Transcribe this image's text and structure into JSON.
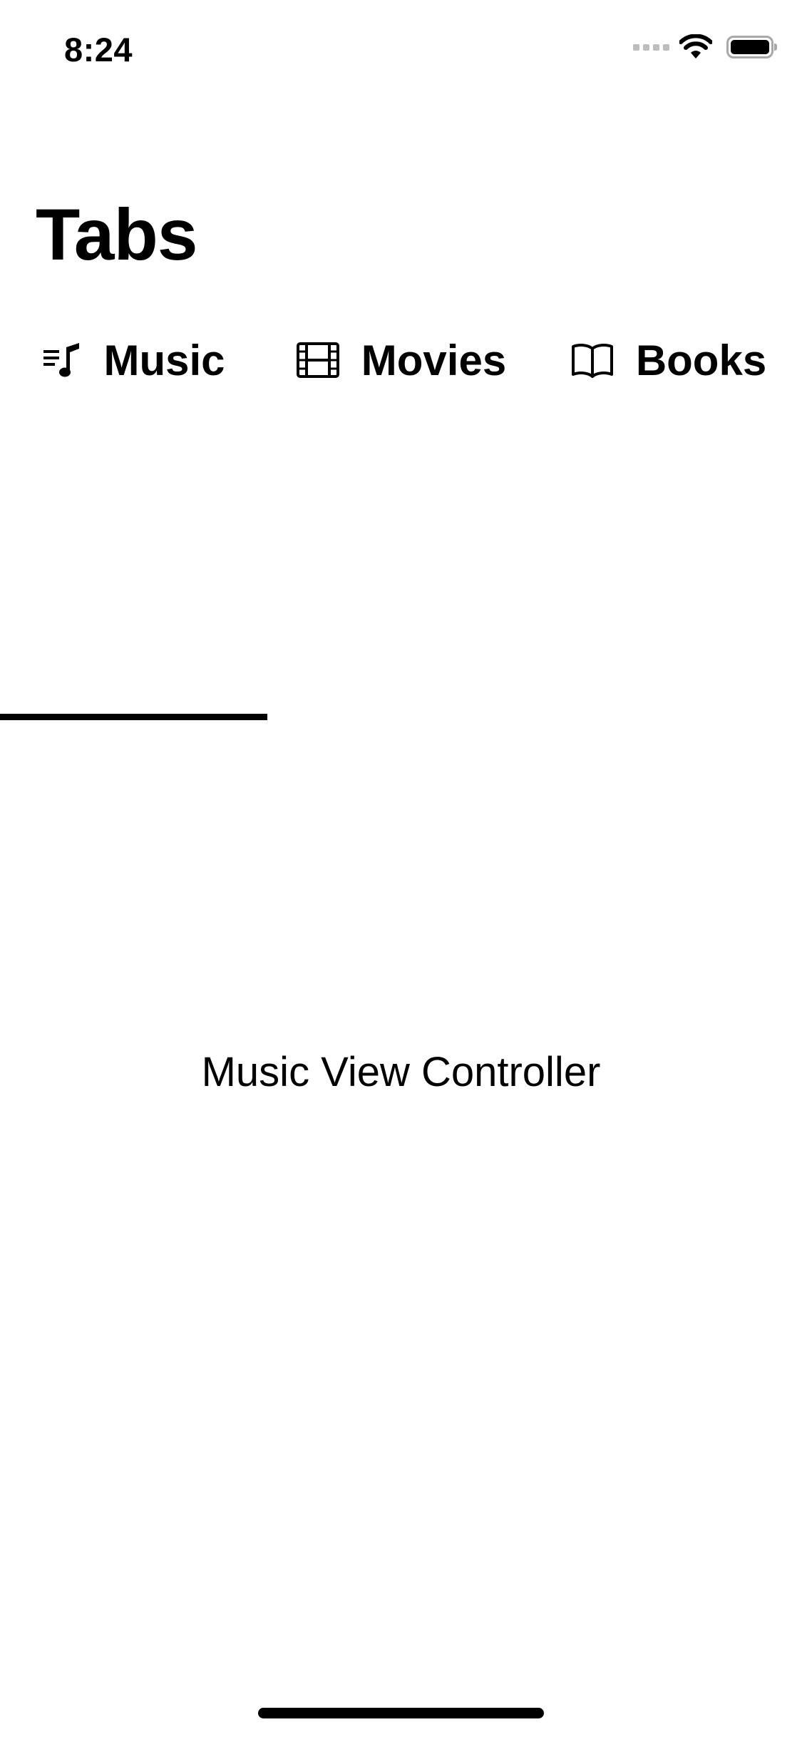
{
  "status_bar": {
    "time": "8:24",
    "icons": [
      "signal-dots-icon",
      "wifi-icon",
      "battery-icon"
    ]
  },
  "header": {
    "title": "Tabs"
  },
  "tabs": [
    {
      "label": "Music",
      "icon": "music-list-icon",
      "selected": true
    },
    {
      "label": "Movies",
      "icon": "film-icon",
      "selected": false
    },
    {
      "label": "Books",
      "icon": "book-icon",
      "selected": false
    }
  ],
  "content": {
    "text": "Music View Controller"
  },
  "colors": {
    "text": "#000000",
    "background": "#ffffff",
    "indicator": "#000000"
  }
}
